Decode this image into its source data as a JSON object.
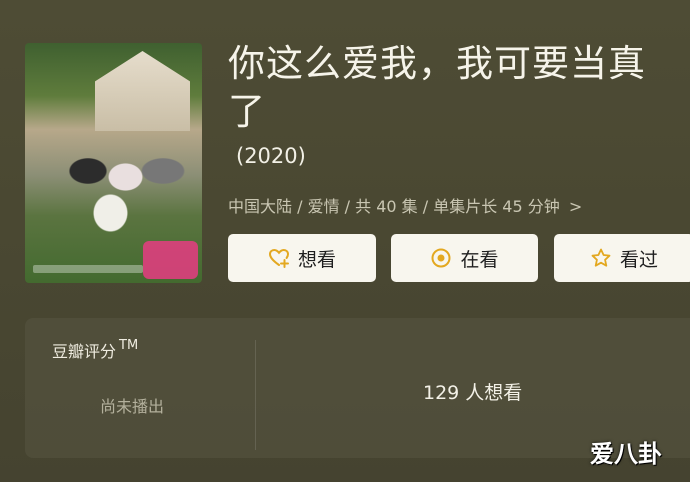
{
  "movie": {
    "title": "你这么爱我，我可要当真了",
    "year": "(2020)",
    "meta": "中国大陆 / 爱情 / 共 40 集 / 单集片长 45 分钟",
    "meta_chevron": ">"
  },
  "actions": {
    "want_label": "想看",
    "watching_label": "在看",
    "watched_label": "看过"
  },
  "rating": {
    "label": "豆瓣评分",
    "trademark": "TM",
    "status": "尚未播出",
    "want_count": "129 人想看"
  },
  "watermark": "爱八卦",
  "icons": {
    "want": "heart-plus-icon",
    "watching": "target-circle-icon",
    "watched": "star-outline-icon"
  },
  "colors": {
    "icon_accent": "#e3a820",
    "button_bg": "#f8f6ee",
    "background": "#4a4832"
  }
}
